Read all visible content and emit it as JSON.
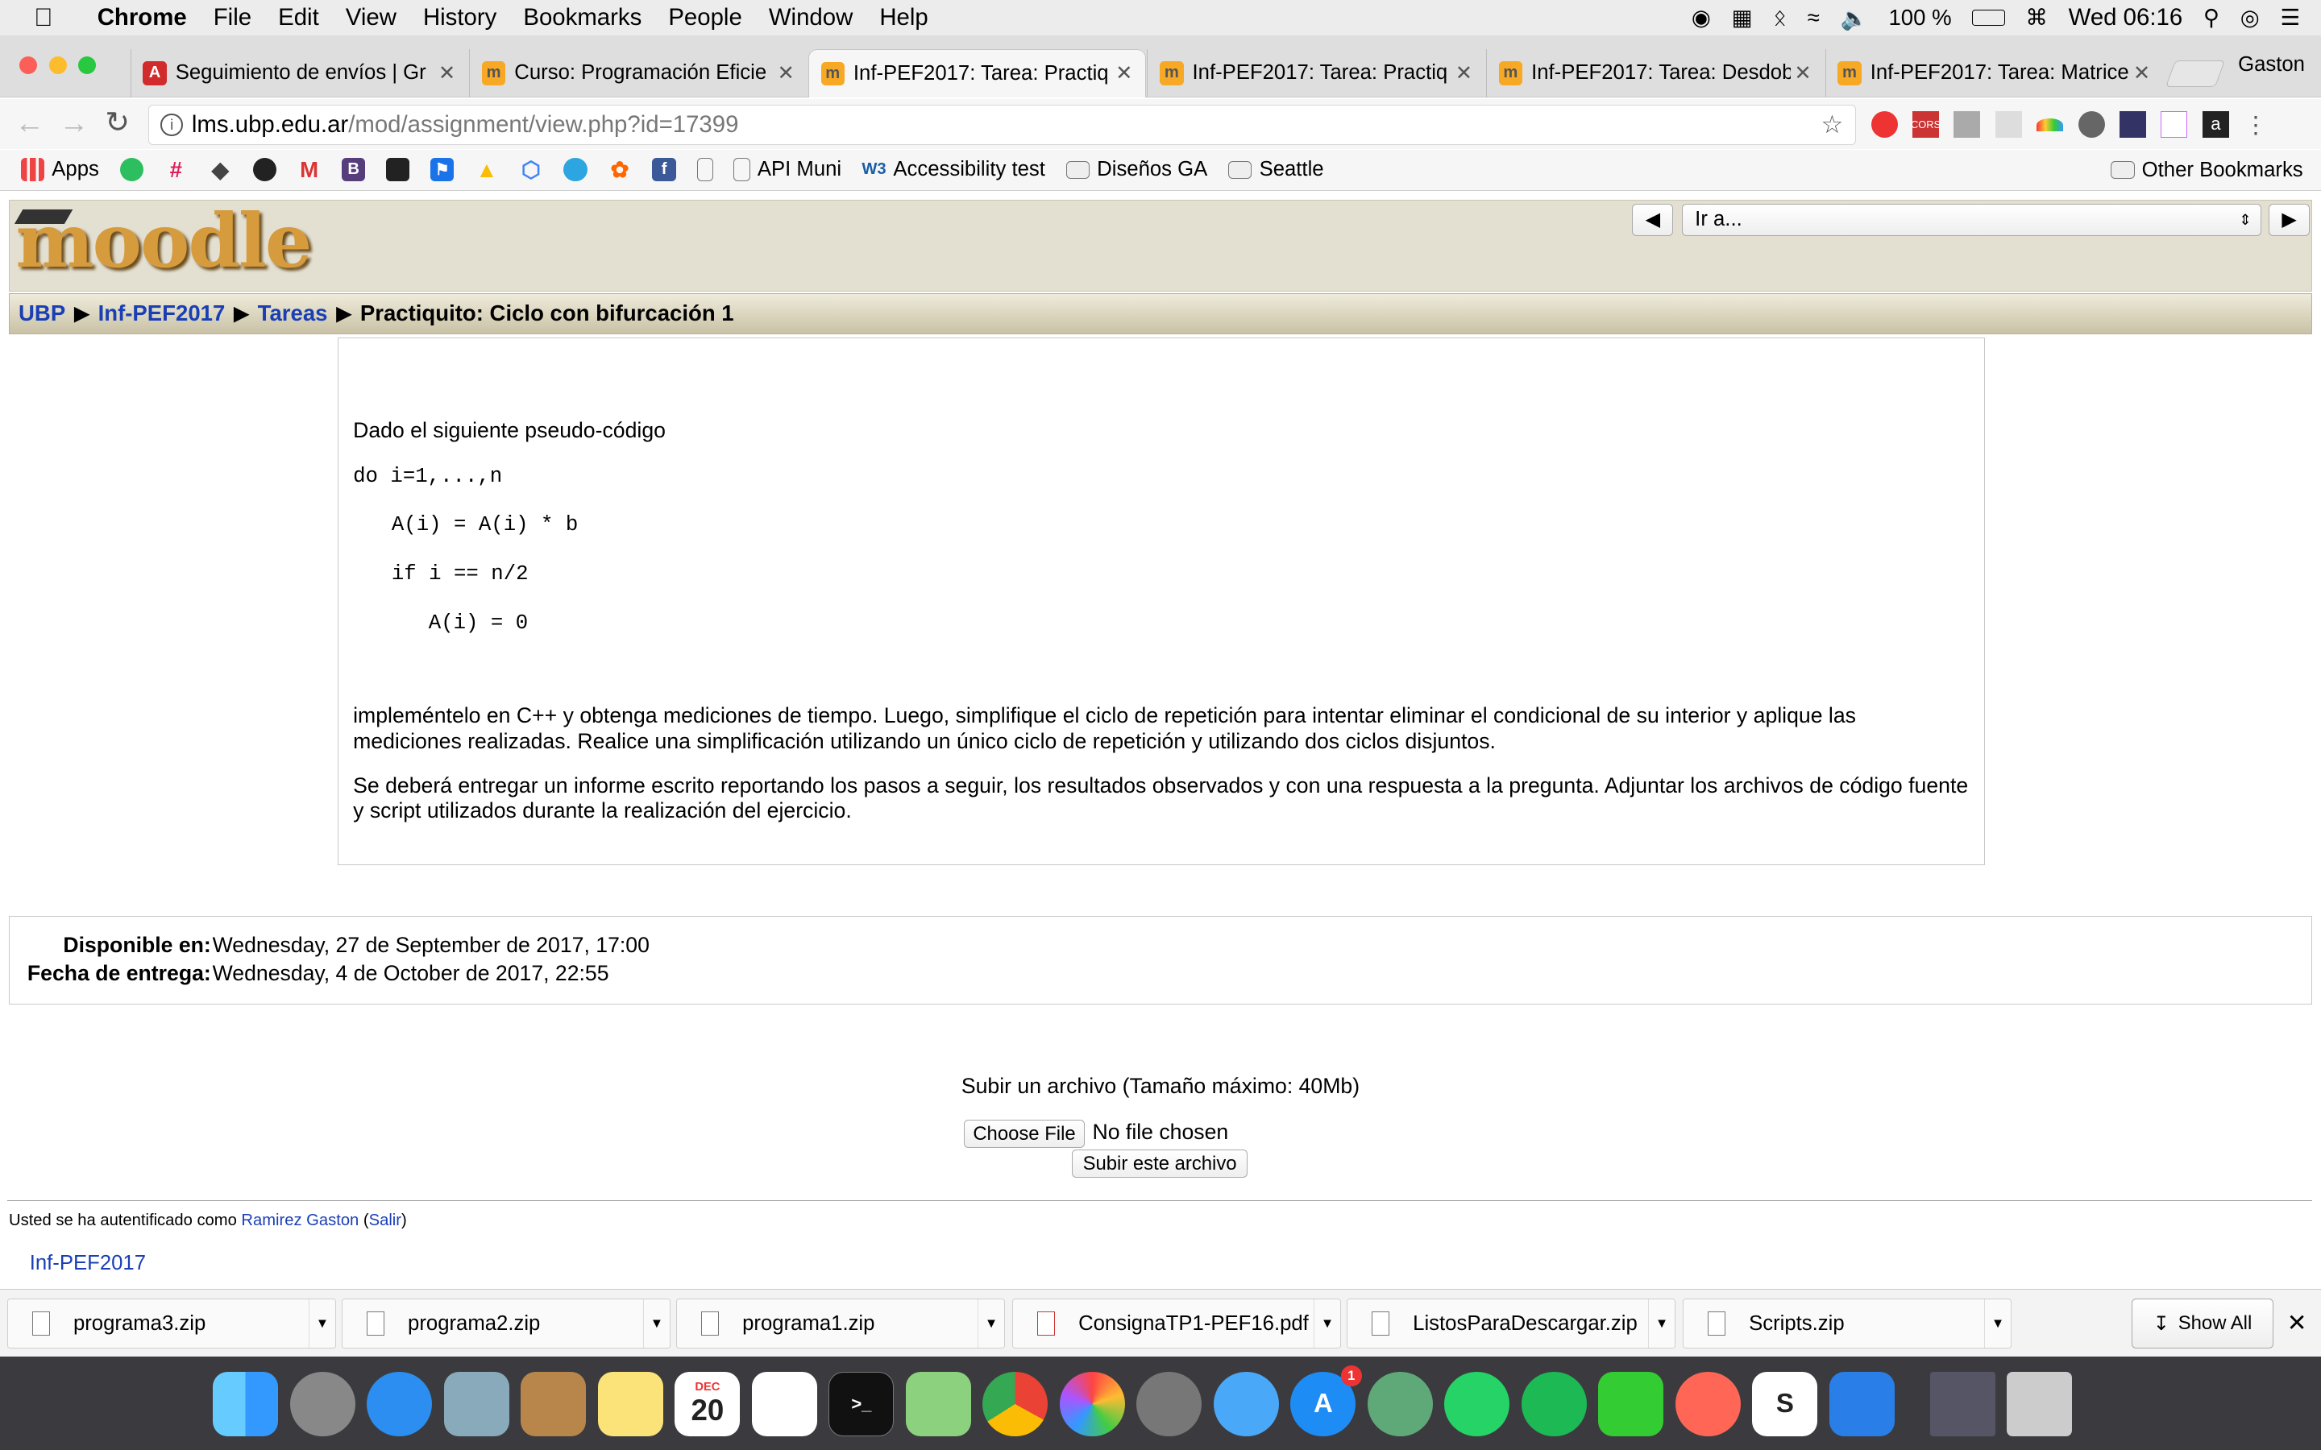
{
  "menubar": {
    "apple": "",
    "app": "Chrome",
    "items": [
      "File",
      "Edit",
      "View",
      "History",
      "Bookmarks",
      "People",
      "Window",
      "Help"
    ],
    "battery": "100 %",
    "clock": "Wed 06:16"
  },
  "profile_name": "Gaston",
  "tabs": [
    {
      "title": "Seguimiento de envíos | Gr",
      "favicon": "A",
      "color": "#d12b2b"
    },
    {
      "title": "Curso: Programación Eficie",
      "favicon": "m",
      "color": "#f7a825"
    },
    {
      "title": "Inf-PEF2017: Tarea: Practiq",
      "favicon": "m",
      "color": "#f7a825"
    },
    {
      "title": "Inf-PEF2017: Tarea: Practiq",
      "favicon": "m",
      "color": "#f7a825"
    },
    {
      "title": "Inf-PEF2017: Tarea: Desdob",
      "favicon": "m",
      "color": "#f7a825"
    },
    {
      "title": "Inf-PEF2017: Tarea: Matrice",
      "favicon": "m",
      "color": "#f7a825"
    }
  ],
  "address": {
    "host": "lms.ubp.edu.ar",
    "path": "/mod/assignment/view.php?id=17399"
  },
  "bookmarks": {
    "apps": "Apps",
    "api_muni": "API Muni",
    "accessibility": "Accessibility test",
    "disenos": "Diseños GA",
    "seattle": "Seattle",
    "other": "Other Bookmarks"
  },
  "moodle": {
    "logo": "moodle",
    "jump_select": "Ir a...",
    "breadcrumb": [
      "UBP",
      "Inf-PEF2017",
      "Tareas",
      "Practiquito: Ciclo con bifurcación 1"
    ]
  },
  "assignment": {
    "intro_line": "Dado el siguiente pseudo-código",
    "code": [
      "do i=1,...,n",
      "A(i) = A(i) * b",
      "if i == n/2",
      "A(i) = 0"
    ],
    "p1": "impleméntelo en C++ y obtenga mediciones de tiempo. Luego, simplifique el ciclo de repetición para intentar eliminar el condicional de su interior y aplique las mediciones realizadas. Realice una simplificación utilizando un único ciclo de repetición y utilizando dos ciclos disjuntos.",
    "p2": "Se deberá entregar un informe escrito reportando los pasos a seguir, los resultados observados y con una respuesta a la pregunta. Adjuntar los archivos de código fuente y script utilizados durante la realización del ejercicio."
  },
  "dates": {
    "available_label": "Disponible en:",
    "available_value": "Wednesday, 27 de September de 2017, 17:00",
    "due_label": "Fecha de entrega:",
    "due_value": "Wednesday, 4 de October de 2017, 22:55"
  },
  "upload": {
    "title": "Subir un archivo (Tamaño máximo: 40Mb)",
    "choose": "Choose File",
    "no_file": "No file chosen",
    "submit": "Subir este archivo"
  },
  "footer": {
    "logged_prefix": "Usted se ha autentificado como ",
    "user": "Ramirez Gaston",
    "logout": "Salir",
    "course": "Inf-PEF2017"
  },
  "downloads": [
    "programa3.zip",
    "programa2.zip",
    "programa1.zip",
    "ConsignaTP1-PEF16.pdf",
    "ListosParaDescargar.zip",
    "Scripts.zip"
  ],
  "downloads_show_all": "Show All",
  "dock": {
    "calendar_month": "DEC",
    "calendar_day": "20",
    "appstore_badge": "1"
  }
}
